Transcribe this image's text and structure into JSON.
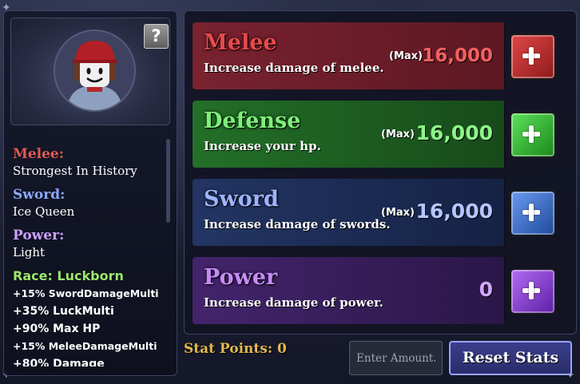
{
  "profile": {
    "help_label": "?",
    "melee_label": "Melee:",
    "melee_value": "Strongest In History",
    "sword_label": "Sword:",
    "sword_value": "Ice Queen",
    "power_label": "Power:",
    "power_value": "Light",
    "race": "Race: Luckborn",
    "buffs": [
      "+15% SwordDamageMulti",
      "+35% LuckMulti",
      "+90% Max HP",
      "+15% MeleeDamageMulti",
      "+80% Damage"
    ]
  },
  "stats": [
    {
      "name": "Melee",
      "description": "Increase damage of melee.",
      "max_label": "(Max)",
      "value": "16,000",
      "color": "#e84a4a",
      "bar_color": "#6b1f28",
      "button_color": "#c42d2d"
    },
    {
      "name": "Defense",
      "description": "Increase your hp.",
      "max_label": "(Max)",
      "value": "16,000",
      "color": "#7ef07a",
      "bar_color": "#1d5b20",
      "button_color": "#2fb030"
    },
    {
      "name": "Sword",
      "description": "Increase damage of swords.",
      "max_label": "(Max)",
      "value": "16,000",
      "color": "#9cb4ff",
      "bar_color": "#1c2c54",
      "button_color": "#3c70c8"
    },
    {
      "name": "Power",
      "description": "Increase damage of power.",
      "max_label": "",
      "value": "0",
      "color": "#c58cf5",
      "bar_color": "#3a1f5c",
      "button_color": "#8c3ce0"
    }
  ],
  "footer": {
    "stat_points": "Stat Points: 0",
    "amount_placeholder": "Enter Amount..",
    "reset_label": "Reset Stats"
  },
  "colors": {
    "melee_label": "#e05a4e",
    "sword_label": "#8aa8ff",
    "power_label": "#cfa0ff",
    "race": "#9be86e",
    "stat_points": "#e3b84e",
    "reset_border": "#9aa2ff"
  }
}
